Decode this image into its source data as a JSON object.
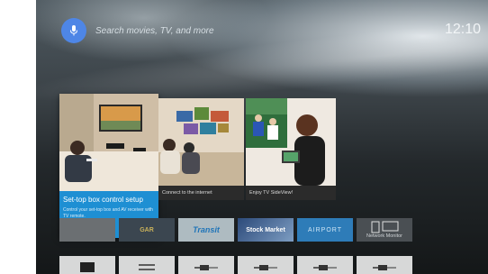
{
  "search": {
    "placeholder": "Search movies, TV, and more"
  },
  "clock": "12:10",
  "featured": [
    {
      "title": "Set-top box control setup",
      "subtitle": "Control your set-top box and AV receiver with TV remote."
    },
    {
      "caption": "Connect to the internet"
    },
    {
      "caption": "Enjoy TV SideView!"
    }
  ],
  "apps_row": [
    {
      "label": "",
      "name": "app-tile-1"
    },
    {
      "label": "GAR",
      "name": "app-tile-2"
    },
    {
      "label": "Transit",
      "name": "app-tile-transit"
    },
    {
      "label": "Stock Market",
      "name": "app-tile-stock-market"
    },
    {
      "label": "AIRPORT",
      "name": "app-tile-airport"
    },
    {
      "label": "Network Monitor",
      "name": "app-tile-network-monitor"
    }
  ],
  "colors": {
    "accent_blue": "#1e8fd3",
    "mic_blue": "#4e86e6"
  }
}
